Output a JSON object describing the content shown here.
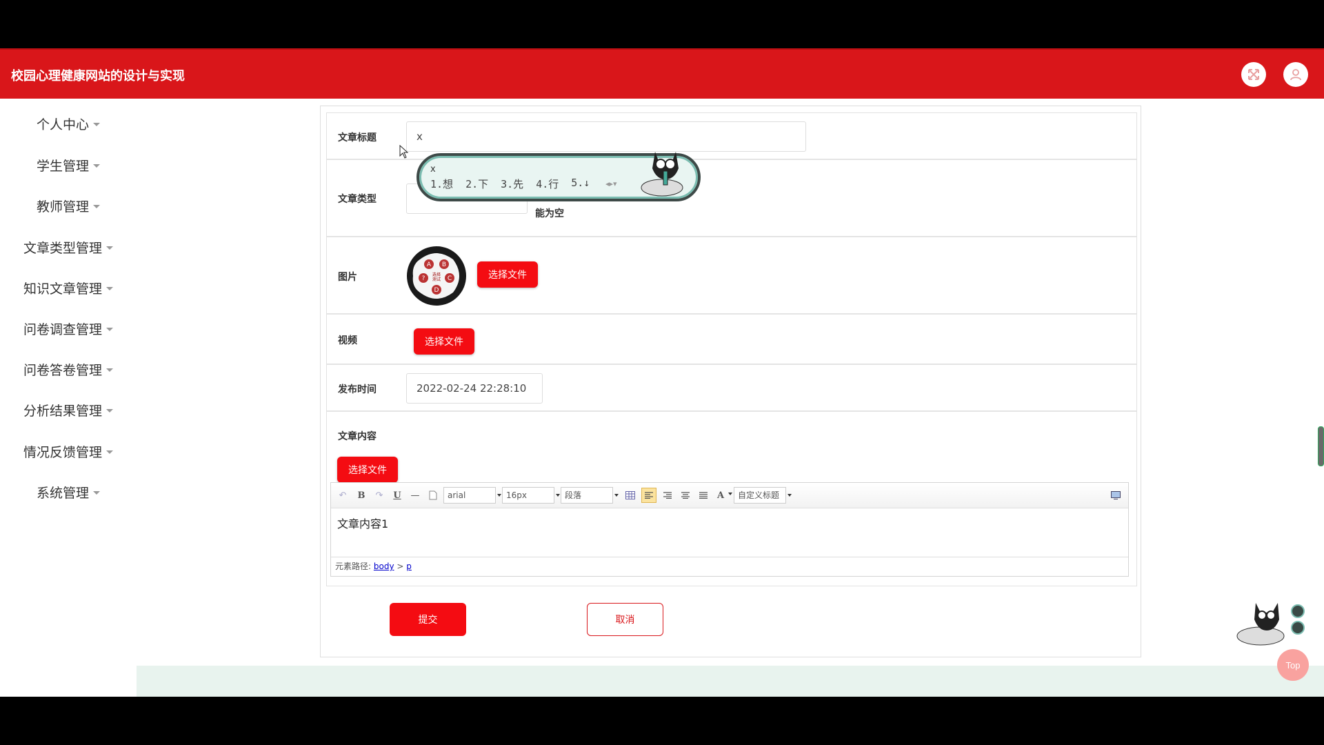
{
  "header": {
    "title": "校园心理健康网站的设计与实现",
    "accent_color": "#d9161a",
    "fullscreen_icon": "fullscreen-icon",
    "user_icon": "user-icon"
  },
  "sidebar": {
    "items": [
      {
        "label": "个人中心"
      },
      {
        "label": "学生管理"
      },
      {
        "label": "教师管理"
      },
      {
        "label": "文章类型管理"
      },
      {
        "label": "知识文章管理"
      },
      {
        "label": "问卷调查管理"
      },
      {
        "label": "问卷答卷管理"
      },
      {
        "label": "分析结果管理"
      },
      {
        "label": "情况反馈管理"
      },
      {
        "label": "系统管理"
      }
    ]
  },
  "form": {
    "title_label": "文章标题",
    "title_value": "x",
    "type_label": "文章类型",
    "type_value": "",
    "type_hint": "能为空",
    "image_label": "图片",
    "image_button": "选择文件",
    "image_text": {
      "l1": "A",
      "l2": "B",
      "l3": "选择",
      "l4": "测试",
      "l5": "?",
      "l6": "C",
      "l7": "D"
    },
    "video_label": "视频",
    "video_button": "选择文件",
    "publish_time_label": "发布时间",
    "publish_time_value": "2022-02-24 22:28:10",
    "content_label": "文章内容",
    "content_button": "选择文件"
  },
  "editor": {
    "toolbar": {
      "undo": "↶",
      "bold": "B",
      "redo": "↷",
      "underline": "U",
      "horizontal_rule": "—",
      "font_family": "arial",
      "font_size": "16px",
      "paragraph": "段落",
      "font_color": "A",
      "custom_heading": "自定义标题"
    },
    "body_text": "文章内容1",
    "path_label": "元素路径:",
    "path_body": "body",
    "path_sep": ">",
    "path_p": "p"
  },
  "actions": {
    "submit": "提交",
    "cancel": "取消"
  },
  "ime": {
    "input": "x",
    "candidates": [
      "1.想",
      "2.下",
      "3.先",
      "4.行",
      "5.↓"
    ]
  },
  "top_button": "Top"
}
